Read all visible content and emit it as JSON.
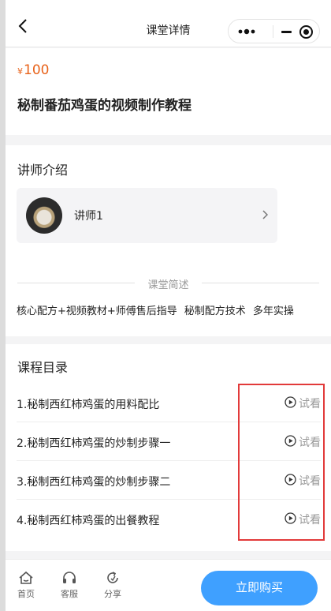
{
  "navbar": {
    "title": "课堂详情"
  },
  "course": {
    "currency": "¥",
    "price": "100",
    "title": "秘制番茄鸡蛋的视频制作教程"
  },
  "teacher_section": {
    "title": "讲师介绍",
    "teacher_name": "讲师1"
  },
  "summary": {
    "label": "课堂简述",
    "tags": [
      "核心配方+视频教材+师傅售后指导",
      "秘制配方技术",
      "多年实操"
    ]
  },
  "catalog": {
    "title": "课程目录",
    "lessons": [
      {
        "name": "1.秘制西红柿鸡蛋的用料配比",
        "action": "试看"
      },
      {
        "name": "2.秘制西红柿鸡蛋的炒制步骤一",
        "action": "试看"
      },
      {
        "name": "3.秘制西红柿鸡蛋的炒制步骤二",
        "action": "试看"
      },
      {
        "name": "4.秘制西红柿鸡蛋的出餐教程",
        "action": "试看"
      }
    ]
  },
  "bottom_bar": {
    "tabs": [
      {
        "label": "首页",
        "icon": "home-icon"
      },
      {
        "label": "客服",
        "icon": "headset-icon"
      },
      {
        "label": "分享",
        "icon": "share-icon"
      }
    ],
    "buy_label": "立即购买"
  },
  "colors": {
    "price": "#e8631b",
    "buy_button": "#3fa0ff",
    "highlight_box": "#e23a3a"
  }
}
